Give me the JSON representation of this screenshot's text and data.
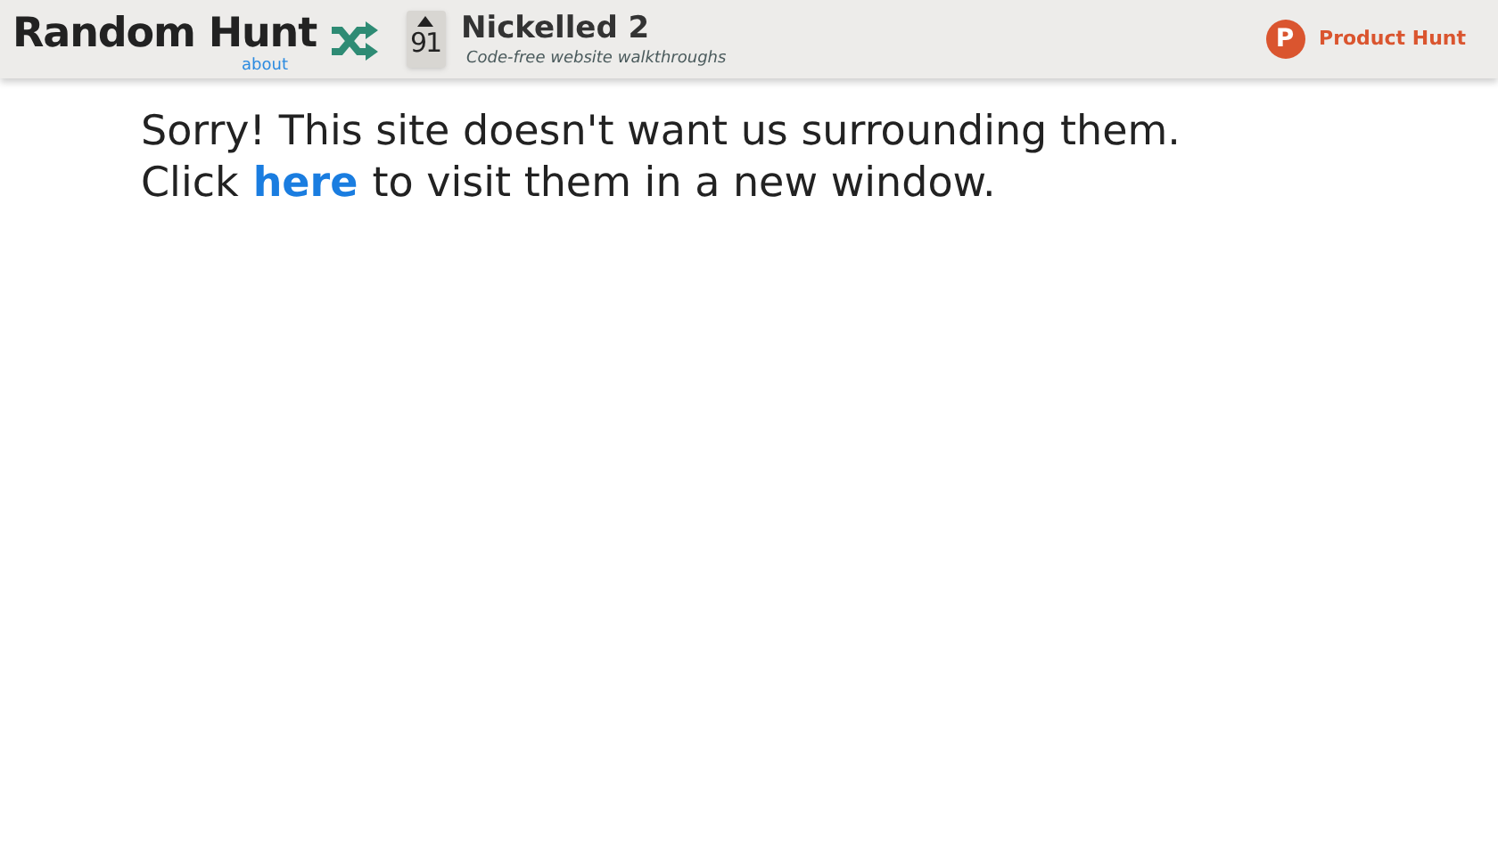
{
  "header": {
    "site_title": "Random Hunt",
    "about_link": "about",
    "vote_count": "91",
    "product_name": "Nickelled 2",
    "product_tagline": "Code-free website walkthroughs",
    "ph_logo_letter": "P",
    "ph_link": "Product Hunt"
  },
  "message": {
    "line_1": "Sorry! This site doesn't want us surrounding them.",
    "line_2_before": "Click",
    "link": "here",
    "line_2_after": "to visit them in a new window."
  }
}
